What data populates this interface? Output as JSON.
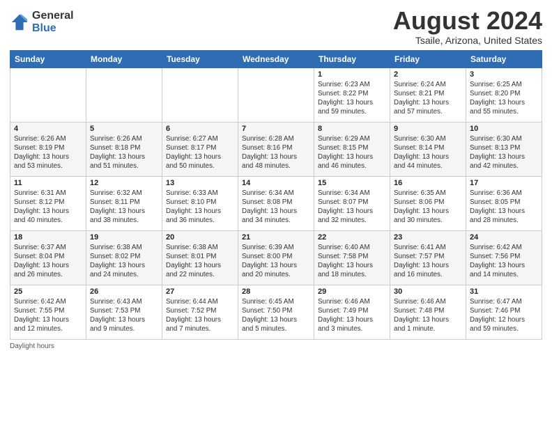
{
  "header": {
    "logo_general": "General",
    "logo_blue": "Blue",
    "title": "August 2024",
    "subtitle": "Tsaile, Arizona, United States"
  },
  "days_of_week": [
    "Sunday",
    "Monday",
    "Tuesday",
    "Wednesday",
    "Thursday",
    "Friday",
    "Saturday"
  ],
  "weeks": [
    [
      {
        "day": "",
        "info": ""
      },
      {
        "day": "",
        "info": ""
      },
      {
        "day": "",
        "info": ""
      },
      {
        "day": "",
        "info": ""
      },
      {
        "day": "1",
        "info": "Sunrise: 6:23 AM\nSunset: 8:22 PM\nDaylight: 13 hours\nand 59 minutes."
      },
      {
        "day": "2",
        "info": "Sunrise: 6:24 AM\nSunset: 8:21 PM\nDaylight: 13 hours\nand 57 minutes."
      },
      {
        "day": "3",
        "info": "Sunrise: 6:25 AM\nSunset: 8:20 PM\nDaylight: 13 hours\nand 55 minutes."
      }
    ],
    [
      {
        "day": "4",
        "info": "Sunrise: 6:26 AM\nSunset: 8:19 PM\nDaylight: 13 hours\nand 53 minutes."
      },
      {
        "day": "5",
        "info": "Sunrise: 6:26 AM\nSunset: 8:18 PM\nDaylight: 13 hours\nand 51 minutes."
      },
      {
        "day": "6",
        "info": "Sunrise: 6:27 AM\nSunset: 8:17 PM\nDaylight: 13 hours\nand 50 minutes."
      },
      {
        "day": "7",
        "info": "Sunrise: 6:28 AM\nSunset: 8:16 PM\nDaylight: 13 hours\nand 48 minutes."
      },
      {
        "day": "8",
        "info": "Sunrise: 6:29 AM\nSunset: 8:15 PM\nDaylight: 13 hours\nand 46 minutes."
      },
      {
        "day": "9",
        "info": "Sunrise: 6:30 AM\nSunset: 8:14 PM\nDaylight: 13 hours\nand 44 minutes."
      },
      {
        "day": "10",
        "info": "Sunrise: 6:30 AM\nSunset: 8:13 PM\nDaylight: 13 hours\nand 42 minutes."
      }
    ],
    [
      {
        "day": "11",
        "info": "Sunrise: 6:31 AM\nSunset: 8:12 PM\nDaylight: 13 hours\nand 40 minutes."
      },
      {
        "day": "12",
        "info": "Sunrise: 6:32 AM\nSunset: 8:11 PM\nDaylight: 13 hours\nand 38 minutes."
      },
      {
        "day": "13",
        "info": "Sunrise: 6:33 AM\nSunset: 8:10 PM\nDaylight: 13 hours\nand 36 minutes."
      },
      {
        "day": "14",
        "info": "Sunrise: 6:34 AM\nSunset: 8:08 PM\nDaylight: 13 hours\nand 34 minutes."
      },
      {
        "day": "15",
        "info": "Sunrise: 6:34 AM\nSunset: 8:07 PM\nDaylight: 13 hours\nand 32 minutes."
      },
      {
        "day": "16",
        "info": "Sunrise: 6:35 AM\nSunset: 8:06 PM\nDaylight: 13 hours\nand 30 minutes."
      },
      {
        "day": "17",
        "info": "Sunrise: 6:36 AM\nSunset: 8:05 PM\nDaylight: 13 hours\nand 28 minutes."
      }
    ],
    [
      {
        "day": "18",
        "info": "Sunrise: 6:37 AM\nSunset: 8:04 PM\nDaylight: 13 hours\nand 26 minutes."
      },
      {
        "day": "19",
        "info": "Sunrise: 6:38 AM\nSunset: 8:02 PM\nDaylight: 13 hours\nand 24 minutes."
      },
      {
        "day": "20",
        "info": "Sunrise: 6:38 AM\nSunset: 8:01 PM\nDaylight: 13 hours\nand 22 minutes."
      },
      {
        "day": "21",
        "info": "Sunrise: 6:39 AM\nSunset: 8:00 PM\nDaylight: 13 hours\nand 20 minutes."
      },
      {
        "day": "22",
        "info": "Sunrise: 6:40 AM\nSunset: 7:58 PM\nDaylight: 13 hours\nand 18 minutes."
      },
      {
        "day": "23",
        "info": "Sunrise: 6:41 AM\nSunset: 7:57 PM\nDaylight: 13 hours\nand 16 minutes."
      },
      {
        "day": "24",
        "info": "Sunrise: 6:42 AM\nSunset: 7:56 PM\nDaylight: 13 hours\nand 14 minutes."
      }
    ],
    [
      {
        "day": "25",
        "info": "Sunrise: 6:42 AM\nSunset: 7:55 PM\nDaylight: 13 hours\nand 12 minutes."
      },
      {
        "day": "26",
        "info": "Sunrise: 6:43 AM\nSunset: 7:53 PM\nDaylight: 13 hours\nand 9 minutes."
      },
      {
        "day": "27",
        "info": "Sunrise: 6:44 AM\nSunset: 7:52 PM\nDaylight: 13 hours\nand 7 minutes."
      },
      {
        "day": "28",
        "info": "Sunrise: 6:45 AM\nSunset: 7:50 PM\nDaylight: 13 hours\nand 5 minutes."
      },
      {
        "day": "29",
        "info": "Sunrise: 6:46 AM\nSunset: 7:49 PM\nDaylight: 13 hours\nand 3 minutes."
      },
      {
        "day": "30",
        "info": "Sunrise: 6:46 AM\nSunset: 7:48 PM\nDaylight: 13 hours\nand 1 minute."
      },
      {
        "day": "31",
        "info": "Sunrise: 6:47 AM\nSunset: 7:46 PM\nDaylight: 12 hours\nand 59 minutes."
      }
    ]
  ],
  "footer": "Daylight hours"
}
